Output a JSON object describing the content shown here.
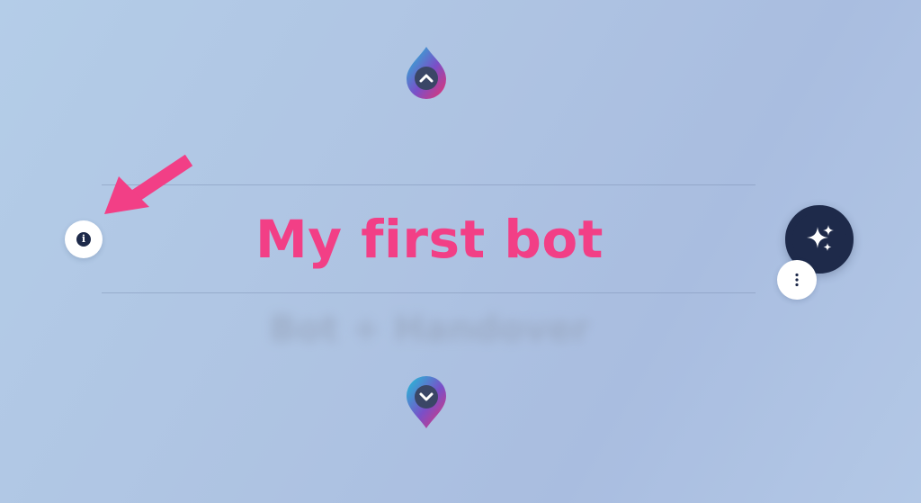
{
  "bot": {
    "name": "My first bot",
    "type": "Bot + Handover"
  },
  "icons": {
    "info": "info-icon",
    "sparkle": "sparkle-icon",
    "more": "more-vertical-icon",
    "pin_up": "chevron-up-pin-icon",
    "pin_down": "chevron-down-pin-icon",
    "annotation": "arrow-pointer-icon"
  },
  "colors": {
    "accent": "#f23f86",
    "dark": "#1e2a4a",
    "gradient_start": "#1ec3d8",
    "gradient_end": "#e8346f"
  },
  "info_glyph": "i"
}
